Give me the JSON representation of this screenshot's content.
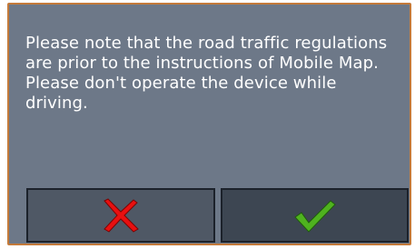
{
  "dialog": {
    "message": "Please note that the road traffic regulations are prior to the instructions of Mobile Map. Please don't operate the device while driving.",
    "cancel_icon": "red-x-icon",
    "confirm_icon": "green-checkmark-icon"
  },
  "colors": {
    "dialog_background": "#6d7888",
    "dialog_border": "#c47a3a",
    "cancel_icon": "#e81010",
    "confirm_icon": "#4fb21f"
  }
}
